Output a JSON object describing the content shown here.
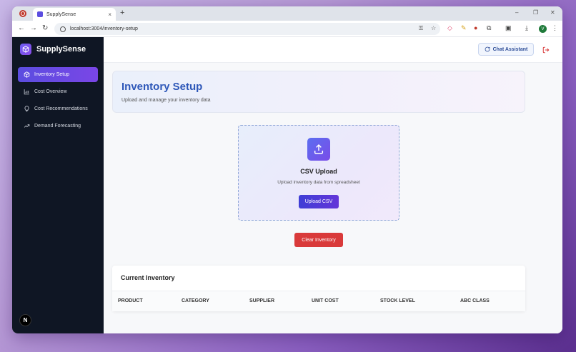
{
  "browser": {
    "tab_title": "SupplySense",
    "tab_close": "×",
    "new_tab": "+",
    "url": "localhost:3004/inventory-setup",
    "profile_initial": "V"
  },
  "sidebar": {
    "brand": "SupplySense",
    "items": [
      {
        "label": "Inventory Setup",
        "icon": "cube-icon",
        "active": true
      },
      {
        "label": "Cost Overview",
        "icon": "bar-chart-icon",
        "active": false
      },
      {
        "label": "Cost Recommendations",
        "icon": "lightbulb-icon",
        "active": false
      },
      {
        "label": "Demand Forecasting",
        "icon": "trend-up-icon",
        "active": false
      }
    ],
    "badge": "N"
  },
  "topbar": {
    "chat_label": "Chat Assistant"
  },
  "page": {
    "title": "Inventory Setup",
    "subtitle": "Upload and manage your inventory data"
  },
  "upload": {
    "title": "CSV Upload",
    "subtitle": "Upload inventory data from spreadsheet",
    "button": "Upload CSV"
  },
  "clear_button": "Clear Inventory",
  "inventory": {
    "title": "Current Inventory",
    "columns": [
      "PRODUCT",
      "CATEGORY",
      "SUPPLIER",
      "UNIT COST",
      "STOCK LEVEL",
      "ABC CLASS"
    ]
  },
  "colors": {
    "accent": "#5b4de0",
    "sidebar_bg": "#0f1624",
    "title_blue": "#2d57b8",
    "danger": "#d93a3a"
  }
}
